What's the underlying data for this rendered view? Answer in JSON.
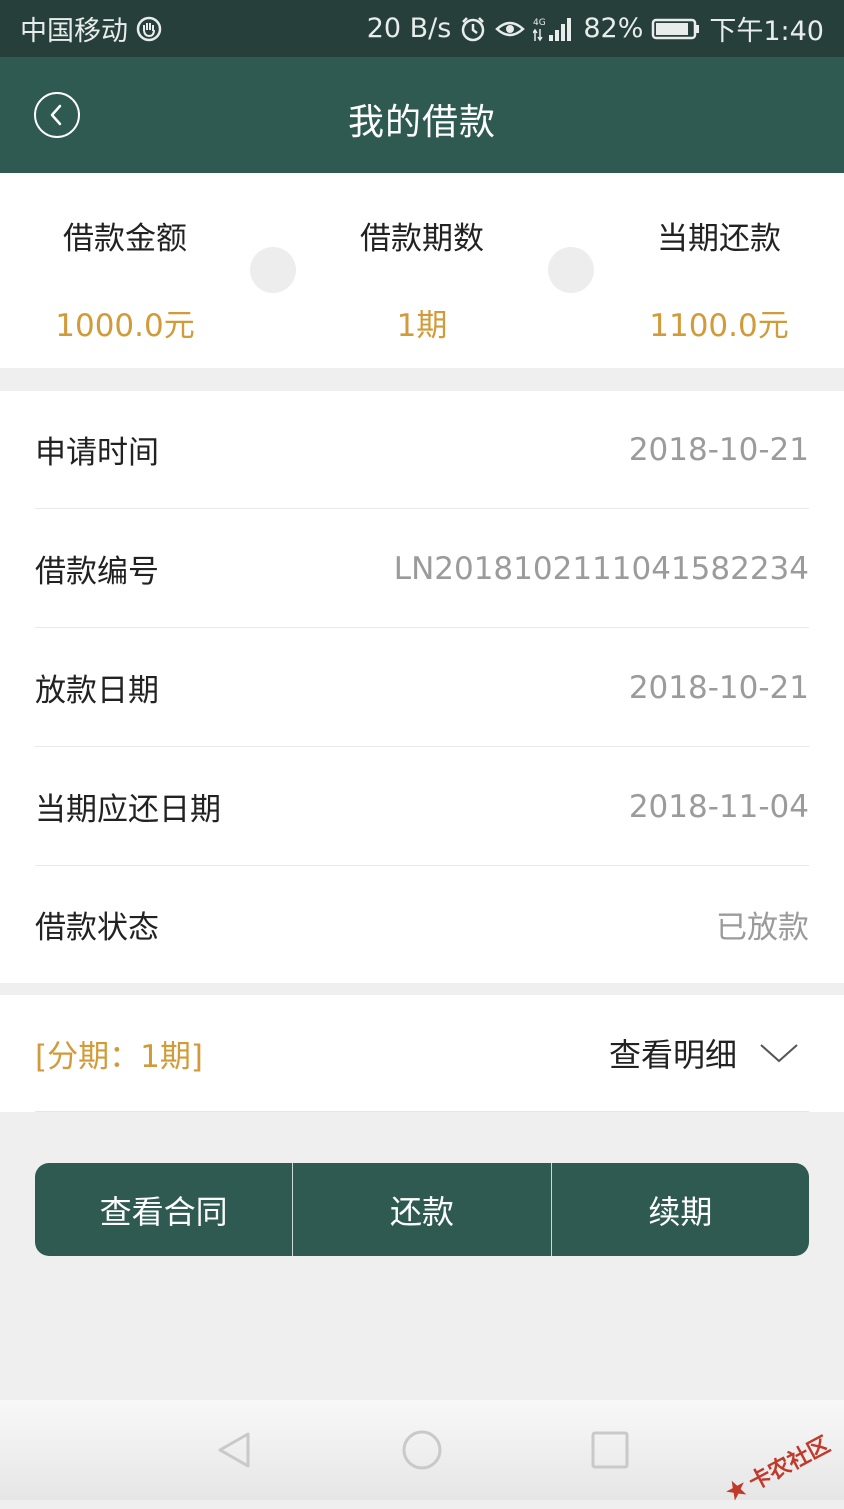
{
  "status_bar": {
    "carrier": "中国移动",
    "speed": "20 B/s",
    "network": "4G",
    "battery": "82%",
    "time": "下午1:40",
    "icons": [
      "hand-icon",
      "alarm-icon",
      "eye-icon",
      "signal-icon",
      "battery-icon"
    ]
  },
  "header": {
    "title": "我的借款",
    "back_icon": "back-icon"
  },
  "summary": {
    "amount_label": "借款金额",
    "amount_value": "1000.0元",
    "periods_label": "借款期数",
    "periods_value": "1期",
    "repayment_label": "当期还款",
    "repayment_value": "1100.0元"
  },
  "details": {
    "rows": [
      {
        "label": "申请时间",
        "value": "2018-10-21"
      },
      {
        "label": "借款编号",
        "value": "LN20181021110415822​34"
      },
      {
        "label": "放款日期",
        "value": "2018-10-21"
      },
      {
        "label": "当期应还日期",
        "value": "2018-11-04"
      },
      {
        "label": "借款状态",
        "value": "已放款"
      }
    ]
  },
  "installment": {
    "tag": "[分期：1期]",
    "detail_label": "查看明细"
  },
  "actions": {
    "contract": "查看合同",
    "repay": "还款",
    "renew": "续期"
  },
  "watermark": {
    "text": "卡农社区"
  },
  "colors": {
    "primary": "#2e5a52",
    "status_bar": "#263f3a",
    "accent": "#d29b3a",
    "value_gray": "#9b9b9b",
    "background": "#efefef"
  }
}
